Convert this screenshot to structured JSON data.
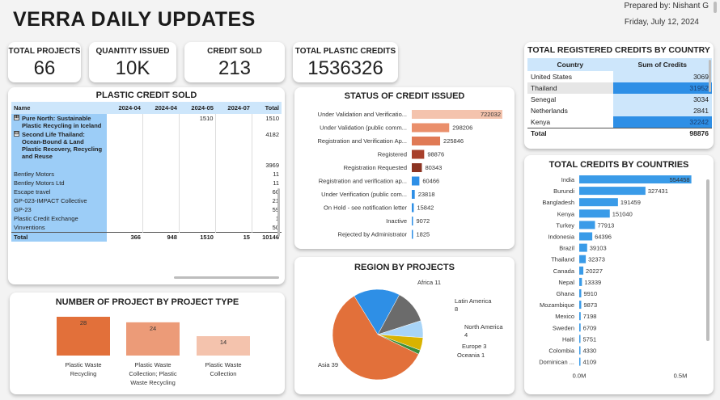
{
  "header": {
    "title": "VERRA DAILY UPDATES",
    "prepared_by": "Prepared by: Nishant G",
    "date": "Friday, July 12, 2024"
  },
  "kpis": [
    {
      "label": "TOTAL PROJECTS",
      "value": "66"
    },
    {
      "label": "QUANTITY ISSUED",
      "value": "10K"
    },
    {
      "label": "CREDIT SOLD",
      "value": "213"
    },
    {
      "label": "TOTAL PLASTIC CREDITS",
      "value": "1536326"
    }
  ],
  "plastic_credit_sold": {
    "title": "PLASTIC CREDIT SOLD",
    "columns": [
      "Name",
      "2024-04",
      "2024-04",
      "2024-05",
      "2024-07",
      "Total"
    ],
    "rows": [
      {
        "expander": "⊞",
        "name": "Pure North: Sustainable Plastic Recycling in Iceland",
        "vals": [
          "",
          "",
          "1510",
          "",
          "1510"
        ],
        "bold": true
      },
      {
        "expander": "⊟",
        "name": "Second Life Thailand: Ocean-Bound & Land Plastic Recovery, Recycling and Reuse",
        "vals": [
          "",
          "",
          "",
          "",
          "4182"
        ],
        "bold": true
      },
      {
        "expander": "",
        "name": "",
        "vals": [
          "",
          "",
          "",
          "",
          "3969"
        ],
        "bold": false
      },
      {
        "expander": "",
        "name": "Bentley Motors",
        "vals": [
          "",
          "",
          "",
          "",
          "11"
        ],
        "bold": false
      },
      {
        "expander": "",
        "name": "Bentley Motors Ltd",
        "vals": [
          "",
          "",
          "",
          "",
          "11"
        ],
        "bold": false
      },
      {
        "expander": "",
        "name": "Escape travel",
        "vals": [
          "",
          "",
          "",
          "",
          "60"
        ],
        "bold": false
      },
      {
        "expander": "",
        "name": "GP-023-IMPACT Collective",
        "vals": [
          "",
          "",
          "",
          "",
          "21"
        ],
        "bold": false
      },
      {
        "expander": "",
        "name": "GP-23",
        "vals": [
          "",
          "",
          "",
          "",
          "59"
        ],
        "bold": false
      },
      {
        "expander": "",
        "name": "Plastic Credit Exchange",
        "vals": [
          "",
          "",
          "",
          "",
          "1"
        ],
        "bold": false
      },
      {
        "expander": "",
        "name": "Vinventions",
        "vals": [
          "",
          "",
          "",
          "",
          "50"
        ],
        "bold": false
      }
    ],
    "total": {
      "name": "Total",
      "vals": [
        "366",
        "948",
        "1510",
        "15",
        "10146"
      ]
    }
  },
  "registered_credits": {
    "title": "TOTAL REGISTERED CREDITS BY COUNTRY",
    "columns": [
      "Country",
      "Sum of Credits"
    ],
    "rows": [
      {
        "country": "United States",
        "value": "3069"
      },
      {
        "country": "Thailand",
        "value": "31952"
      },
      {
        "country": "Senegal",
        "value": "3034"
      },
      {
        "country": "Netherlands",
        "value": "2841"
      },
      {
        "country": "Kenya",
        "value": "32242"
      }
    ],
    "total": {
      "label": "Total",
      "value": "98876"
    }
  },
  "colors": {
    "status_bars": [
      "#f4c3ad",
      "#ea8f6b",
      "#e07a55",
      "#a8402b",
      "#8b3322",
      "#2e8fe6",
      "#2e8fe6",
      "#2e8fe6",
      "#2e8fe6",
      "#2e8fe6"
    ],
    "country_bar": "#3a9be8",
    "type_bars": [
      "#e2703a",
      "#ec9b78",
      "#f4c3ad"
    ],
    "pie": [
      "#e2703a",
      "#2e8fe6",
      "#6b6b6b",
      "#a8d4f7",
      "#d9b300",
      "#3a8f3a"
    ]
  },
  "chart_data": [
    {
      "type": "bar",
      "title": "STATUS OF CREDIT ISSUED",
      "orientation": "horizontal",
      "categories": [
        "Under Validation and Verificatio...",
        "Under Validation (public comm...",
        "Registration and Verification Ap...",
        "Registered",
        "Registration Requested",
        "Registration and verification ap...",
        "Under Verification (public com...",
        "On Hold - see notification letter",
        "Inactive",
        "Rejected by Administrator"
      ],
      "values": [
        722032,
        298206,
        225846,
        98876,
        80343,
        60466,
        23818,
        15842,
        9072,
        1825
      ],
      "value_labels": [
        "722032",
        "298206",
        "225846",
        "98876",
        "80343",
        "60466",
        "23818",
        "15842",
        "9072",
        "1825"
      ]
    },
    {
      "type": "bar",
      "title": "TOTAL CREDITS BY COUNTRIES",
      "orientation": "horizontal",
      "categories": [
        "India",
        "Burundi",
        "Bangladesh",
        "Kenya",
        "Turkey",
        "Indonesia",
        "Brazil",
        "Thailand",
        "Canada",
        "Nepal",
        "Ghana",
        "Mozambique",
        "Mexico",
        "Sweden",
        "Haiti",
        "Colombia",
        "Dominican ..."
      ],
      "values": [
        554458,
        327431,
        191459,
        151040,
        77913,
        64396,
        39103,
        32373,
        20227,
        13339,
        9910,
        9873,
        7198,
        6709,
        5751,
        4330,
        4109
      ],
      "value_labels": [
        "554458",
        "327431",
        "191459",
        "151040",
        "77913",
        "64396",
        "39103",
        "32373",
        "20227",
        "13339",
        "9910",
        "9873",
        "7198",
        "6709",
        "5751",
        "4330",
        "4109"
      ],
      "xaxis_ticks": [
        "0.0M",
        "0.5M"
      ],
      "xlim": [
        0,
        600000
      ]
    },
    {
      "type": "bar",
      "title": "NUMBER OF PROJECT BY PROJECT TYPE",
      "categories": [
        "Plastic Waste Recycling",
        "Plastic Waste Collection; Plastic Waste Recycling",
        "Plastic Waste Collection"
      ],
      "values": [
        28,
        24,
        14
      ],
      "value_labels": [
        "28",
        "24",
        "14"
      ]
    },
    {
      "type": "pie",
      "title": "REGION BY PROJECTS",
      "categories": [
        "Asia",
        "Africa",
        "Latin America",
        "North America",
        "Europe",
        "Oceania"
      ],
      "values": [
        39,
        11,
        8,
        4,
        3,
        1
      ],
      "labels": [
        "Asia 39",
        "Africa 11",
        "Latin America 8",
        "North America 4",
        "Europe 3",
        "Oceania 1"
      ]
    }
  ]
}
